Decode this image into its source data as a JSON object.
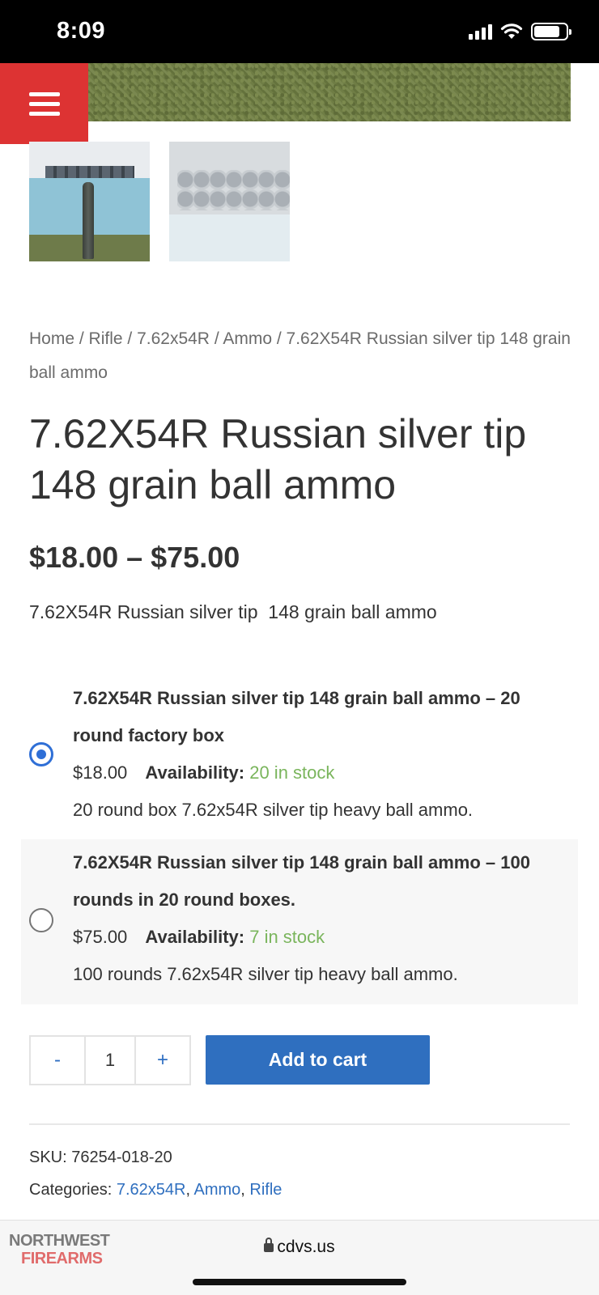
{
  "status_bar": {
    "time": "8:09"
  },
  "breadcrumb": {
    "items": [
      "Home",
      "Rifle",
      "7.62x54R",
      "Ammo"
    ],
    "separator": " / ",
    "current": "7.62X54R Russian silver tip 148 grain ball ammo"
  },
  "product": {
    "title": "7.62X54R Russian silver tip 148 grain ball ammo",
    "price_range": "$18.00 – $75.00",
    "short_description": "7.62X54R Russian silver tip  148 grain ball ammo"
  },
  "variations": [
    {
      "title": "7.62X54R Russian silver tip 148 grain ball ammo – 20 round factory box",
      "price": "$18.00",
      "availability_label": "Availability:",
      "stock": "20 in stock",
      "description": "20 round box 7.62x54R silver tip heavy ball ammo.",
      "selected": true
    },
    {
      "title": "7.62X54R Russian silver tip 148 grain ball ammo – 100 rounds in 20 round boxes.",
      "price": "$75.00",
      "availability_label": "Availability:",
      "stock": "7 in stock",
      "description": "100 rounds 7.62x54R silver tip heavy ball ammo.",
      "selected": false
    }
  ],
  "cart": {
    "minus_label": "-",
    "quantity": "1",
    "plus_label": "+",
    "add_to_cart_label": "Add to cart"
  },
  "meta": {
    "sku_label": "SKU:",
    "sku": "76254-018-20",
    "categories_label": "Categories:",
    "categories": [
      "7.62x54R",
      "Ammo",
      "Rifle"
    ]
  },
  "browser": {
    "url": "cdvs.us",
    "logo_top": "NORTHWEST",
    "logo_bottom": "FIREARMS"
  },
  "colors": {
    "menu_red": "#dd3333",
    "accent_blue": "#2f6fbf",
    "stock_green": "#7ab55c"
  }
}
